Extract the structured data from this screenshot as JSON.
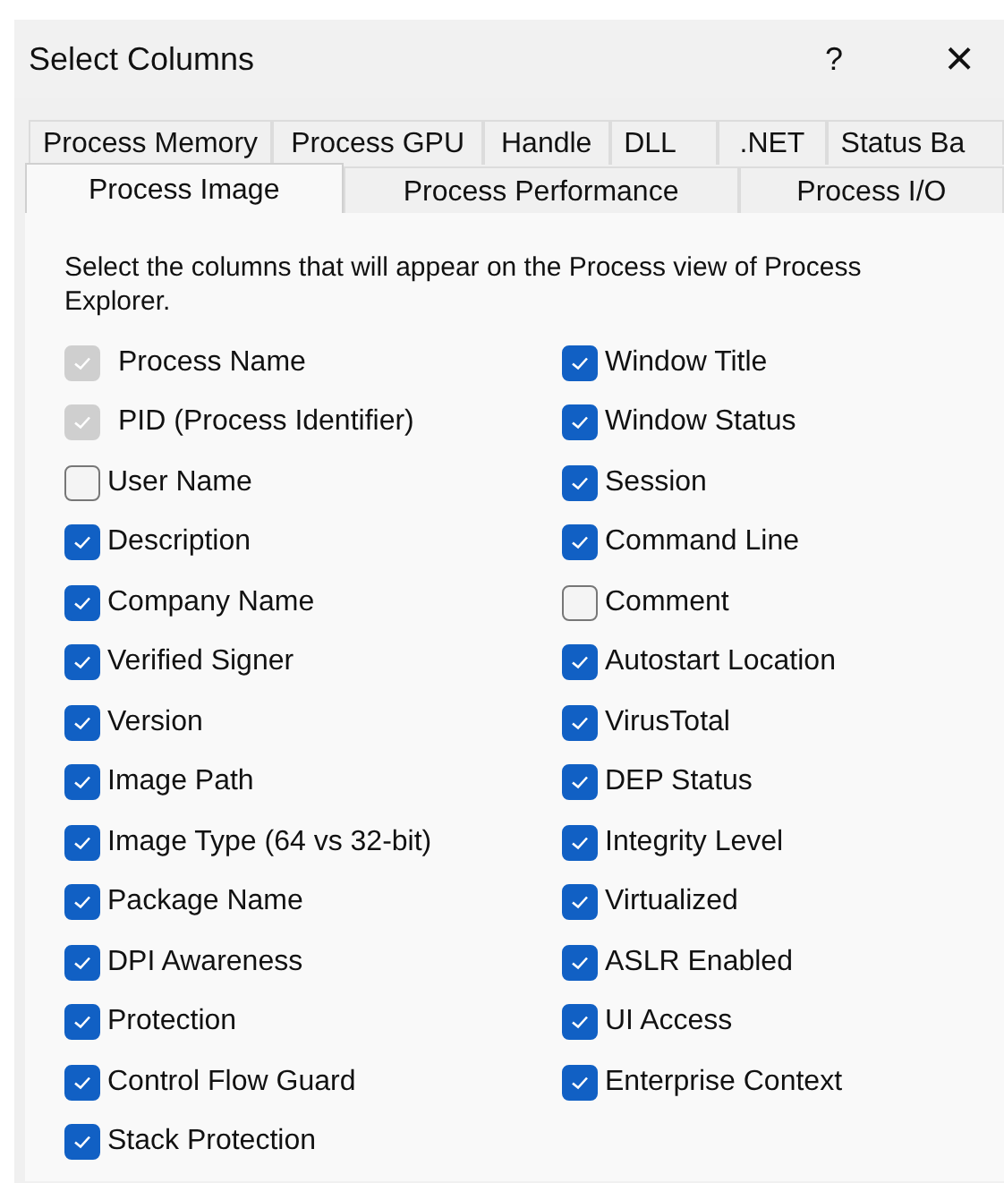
{
  "window": {
    "title": "Select Columns",
    "help": "?",
    "close": "×"
  },
  "tab_rows": [
    [
      {
        "label": "Process Memory",
        "selected": false
      },
      {
        "label": "Process GPU",
        "selected": false
      },
      {
        "label": "Handle",
        "selected": false
      },
      {
        "label": "DLL",
        "selected": false
      },
      {
        "label": ".NET",
        "selected": false
      },
      {
        "label": "Status Ba",
        "selected": false
      }
    ],
    [
      {
        "label": "Process Image",
        "selected": true
      },
      {
        "label": "Process Performance",
        "selected": false
      },
      {
        "label": "Process I/O",
        "selected": false
      }
    ]
  ],
  "instructions": "Select the columns that will appear on the Process view of Process Explorer.",
  "left_column": [
    {
      "label": "Process Name",
      "checked": true,
      "disabled": true
    },
    {
      "label": "PID (Process Identifier)",
      "checked": true,
      "disabled": true
    },
    {
      "label": "User Name",
      "checked": false,
      "disabled": false
    },
    {
      "label": "Description",
      "checked": true,
      "disabled": false
    },
    {
      "label": "Company Name",
      "checked": true,
      "disabled": false
    },
    {
      "label": "Verified Signer",
      "checked": true,
      "disabled": false
    },
    {
      "label": "Version",
      "checked": true,
      "disabled": false
    },
    {
      "label": "Image Path",
      "checked": true,
      "disabled": false
    },
    {
      "label": "Image Type (64 vs 32-bit)",
      "checked": true,
      "disabled": false
    },
    {
      "label": "Package Name",
      "checked": true,
      "disabled": false
    },
    {
      "label": "DPI Awareness",
      "checked": true,
      "disabled": false
    },
    {
      "label": "Protection",
      "checked": true,
      "disabled": false
    },
    {
      "label": "Control Flow Guard",
      "checked": true,
      "disabled": false
    },
    {
      "label": "Stack Protection",
      "checked": true,
      "disabled": false
    }
  ],
  "right_column": [
    {
      "label": "Window Title",
      "checked": true,
      "disabled": false
    },
    {
      "label": "Window Status",
      "checked": true,
      "disabled": false
    },
    {
      "label": "Session",
      "checked": true,
      "disabled": false
    },
    {
      "label": "Command Line",
      "checked": true,
      "disabled": false
    },
    {
      "label": "Comment",
      "checked": false,
      "disabled": false
    },
    {
      "label": "Autostart Location",
      "checked": true,
      "disabled": false
    },
    {
      "label": "VirusTotal",
      "checked": true,
      "disabled": false
    },
    {
      "label": "DEP Status",
      "checked": true,
      "disabled": false
    },
    {
      "label": "Integrity Level",
      "checked": true,
      "disabled": false
    },
    {
      "label": "Virtualized",
      "checked": true,
      "disabled": false
    },
    {
      "label": "ASLR Enabled",
      "checked": true,
      "disabled": false
    },
    {
      "label": "UI Access",
      "checked": true,
      "disabled": false
    },
    {
      "label": "Enterprise Context",
      "checked": true,
      "disabled": false
    }
  ]
}
